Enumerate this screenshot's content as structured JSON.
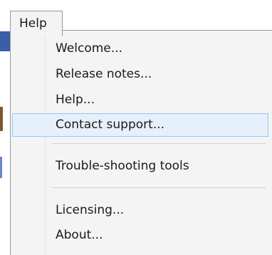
{
  "menubar": {
    "help_title": "Help"
  },
  "menu": {
    "items": [
      {
        "label": "Welcome...",
        "highlighted": false
      },
      {
        "label": "Release notes...",
        "highlighted": false
      },
      {
        "label": "Help...",
        "highlighted": false
      },
      {
        "label": "Contact support...",
        "highlighted": true
      },
      {
        "label": "Trouble-shooting tools",
        "highlighted": false
      },
      {
        "label": "Licensing...",
        "highlighted": false
      },
      {
        "label": "About...",
        "highlighted": false
      }
    ]
  },
  "colors": {
    "menu_background": "#f4f4f4",
    "highlight_background": "#e5f0fb",
    "highlight_border": "#90c8f6",
    "border": "#979797"
  }
}
